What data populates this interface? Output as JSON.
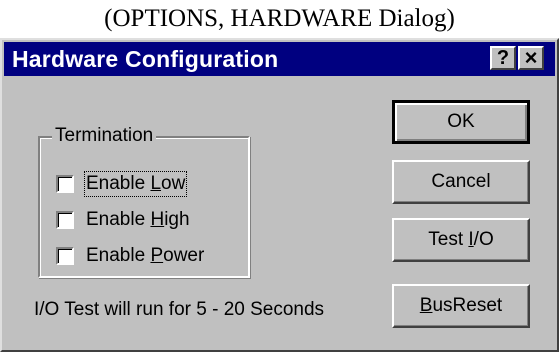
{
  "caption": "(OPTIONS, HARDWARE Dialog)",
  "dialog": {
    "title": "Hardware Configuration",
    "help_button": "?",
    "close_button": "×"
  },
  "termination": {
    "legend": "Termination",
    "options": [
      {
        "pre": "Enable ",
        "mnemonic": "L",
        "post": "ow",
        "checked": false
      },
      {
        "pre": "Enable ",
        "mnemonic": "H",
        "post": "igh",
        "checked": false
      },
      {
        "pre": "Enable ",
        "mnemonic": "P",
        "post": "ower",
        "checked": false
      }
    ]
  },
  "info_text": "I/O Test will run for 5 - 20 Seconds",
  "buttons": {
    "ok": {
      "label": "OK"
    },
    "cancel": {
      "label": "Cancel"
    },
    "test_io": {
      "pre": "Test ",
      "mnemonic": "I",
      "post": "/O"
    },
    "bus_reset": {
      "pre": "",
      "mnemonic": "B",
      "post": "usReset"
    }
  },
  "colors": {
    "titlebar": "#000080",
    "face": "#c0c0c0"
  }
}
